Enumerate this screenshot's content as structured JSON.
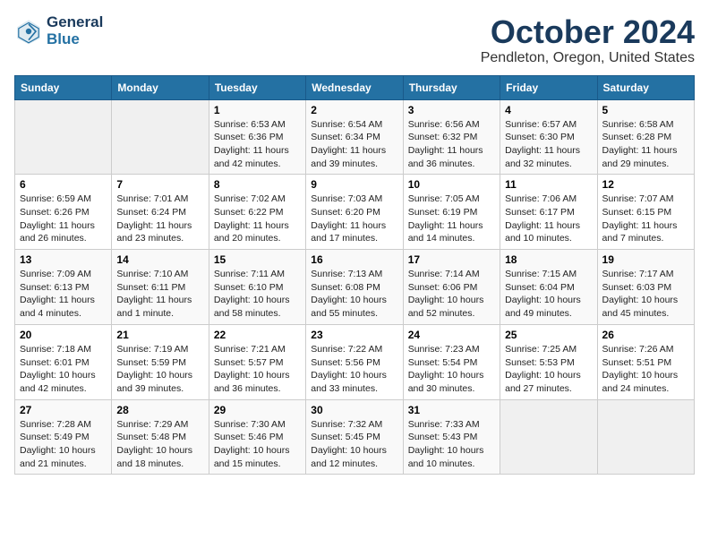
{
  "logo": {
    "line1": "General",
    "line2": "Blue"
  },
  "title": "October 2024",
  "subtitle": "Pendleton, Oregon, United States",
  "headers": [
    "Sunday",
    "Monday",
    "Tuesday",
    "Wednesday",
    "Thursday",
    "Friday",
    "Saturday"
  ],
  "weeks": [
    [
      {
        "day": "",
        "info": ""
      },
      {
        "day": "",
        "info": ""
      },
      {
        "day": "1",
        "info": "Sunrise: 6:53 AM\nSunset: 6:36 PM\nDaylight: 11 hours and 42 minutes."
      },
      {
        "day": "2",
        "info": "Sunrise: 6:54 AM\nSunset: 6:34 PM\nDaylight: 11 hours and 39 minutes."
      },
      {
        "day": "3",
        "info": "Sunrise: 6:56 AM\nSunset: 6:32 PM\nDaylight: 11 hours and 36 minutes."
      },
      {
        "day": "4",
        "info": "Sunrise: 6:57 AM\nSunset: 6:30 PM\nDaylight: 11 hours and 32 minutes."
      },
      {
        "day": "5",
        "info": "Sunrise: 6:58 AM\nSunset: 6:28 PM\nDaylight: 11 hours and 29 minutes."
      }
    ],
    [
      {
        "day": "6",
        "info": "Sunrise: 6:59 AM\nSunset: 6:26 PM\nDaylight: 11 hours and 26 minutes."
      },
      {
        "day": "7",
        "info": "Sunrise: 7:01 AM\nSunset: 6:24 PM\nDaylight: 11 hours and 23 minutes."
      },
      {
        "day": "8",
        "info": "Sunrise: 7:02 AM\nSunset: 6:22 PM\nDaylight: 11 hours and 20 minutes."
      },
      {
        "day": "9",
        "info": "Sunrise: 7:03 AM\nSunset: 6:20 PM\nDaylight: 11 hours and 17 minutes."
      },
      {
        "day": "10",
        "info": "Sunrise: 7:05 AM\nSunset: 6:19 PM\nDaylight: 11 hours and 14 minutes."
      },
      {
        "day": "11",
        "info": "Sunrise: 7:06 AM\nSunset: 6:17 PM\nDaylight: 11 hours and 10 minutes."
      },
      {
        "day": "12",
        "info": "Sunrise: 7:07 AM\nSunset: 6:15 PM\nDaylight: 11 hours and 7 minutes."
      }
    ],
    [
      {
        "day": "13",
        "info": "Sunrise: 7:09 AM\nSunset: 6:13 PM\nDaylight: 11 hours and 4 minutes."
      },
      {
        "day": "14",
        "info": "Sunrise: 7:10 AM\nSunset: 6:11 PM\nDaylight: 11 hours and 1 minute."
      },
      {
        "day": "15",
        "info": "Sunrise: 7:11 AM\nSunset: 6:10 PM\nDaylight: 10 hours and 58 minutes."
      },
      {
        "day": "16",
        "info": "Sunrise: 7:13 AM\nSunset: 6:08 PM\nDaylight: 10 hours and 55 minutes."
      },
      {
        "day": "17",
        "info": "Sunrise: 7:14 AM\nSunset: 6:06 PM\nDaylight: 10 hours and 52 minutes."
      },
      {
        "day": "18",
        "info": "Sunrise: 7:15 AM\nSunset: 6:04 PM\nDaylight: 10 hours and 49 minutes."
      },
      {
        "day": "19",
        "info": "Sunrise: 7:17 AM\nSunset: 6:03 PM\nDaylight: 10 hours and 45 minutes."
      }
    ],
    [
      {
        "day": "20",
        "info": "Sunrise: 7:18 AM\nSunset: 6:01 PM\nDaylight: 10 hours and 42 minutes."
      },
      {
        "day": "21",
        "info": "Sunrise: 7:19 AM\nSunset: 5:59 PM\nDaylight: 10 hours and 39 minutes."
      },
      {
        "day": "22",
        "info": "Sunrise: 7:21 AM\nSunset: 5:57 PM\nDaylight: 10 hours and 36 minutes."
      },
      {
        "day": "23",
        "info": "Sunrise: 7:22 AM\nSunset: 5:56 PM\nDaylight: 10 hours and 33 minutes."
      },
      {
        "day": "24",
        "info": "Sunrise: 7:23 AM\nSunset: 5:54 PM\nDaylight: 10 hours and 30 minutes."
      },
      {
        "day": "25",
        "info": "Sunrise: 7:25 AM\nSunset: 5:53 PM\nDaylight: 10 hours and 27 minutes."
      },
      {
        "day": "26",
        "info": "Sunrise: 7:26 AM\nSunset: 5:51 PM\nDaylight: 10 hours and 24 minutes."
      }
    ],
    [
      {
        "day": "27",
        "info": "Sunrise: 7:28 AM\nSunset: 5:49 PM\nDaylight: 10 hours and 21 minutes."
      },
      {
        "day": "28",
        "info": "Sunrise: 7:29 AM\nSunset: 5:48 PM\nDaylight: 10 hours and 18 minutes."
      },
      {
        "day": "29",
        "info": "Sunrise: 7:30 AM\nSunset: 5:46 PM\nDaylight: 10 hours and 15 minutes."
      },
      {
        "day": "30",
        "info": "Sunrise: 7:32 AM\nSunset: 5:45 PM\nDaylight: 10 hours and 12 minutes."
      },
      {
        "day": "31",
        "info": "Sunrise: 7:33 AM\nSunset: 5:43 PM\nDaylight: 10 hours and 10 minutes."
      },
      {
        "day": "",
        "info": ""
      },
      {
        "day": "",
        "info": ""
      }
    ]
  ]
}
